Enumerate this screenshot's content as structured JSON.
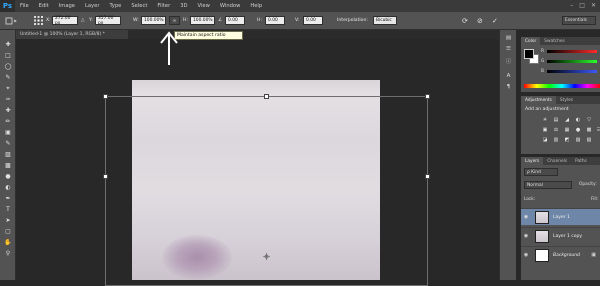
{
  "app": {
    "logo": "Ps"
  },
  "menu": [
    "File",
    "Edit",
    "Image",
    "Layer",
    "Type",
    "Select",
    "Filter",
    "3D",
    "View",
    "Window",
    "Help"
  ],
  "window_controls": [
    "–",
    "□",
    "✕"
  ],
  "options": {
    "x_label": "X:",
    "x_value": "272.00 px",
    "y_label": "Y:",
    "y_value": "357.00 px",
    "w_label": "W:",
    "w_value": "100.00%",
    "link_icon": "∞",
    "h_label": "H:",
    "h_value": "100.00%",
    "angle_value": "0.00",
    "h2_label": "H:",
    "h2_value": "0.00",
    "v_label": "V:",
    "v_value": "0.00",
    "interp_label": "Interpolation:",
    "interp_value": "Bicubic",
    "commit_icons": [
      "⟳",
      "⊘",
      "✓"
    ],
    "workspace": "Essentials"
  },
  "tooltip": "Maintain aspect ratio",
  "document_tab": "Untitled-1 @ 100% (Layer 1, RGB/8) *",
  "color_panel": {
    "tabs": [
      "Color",
      "Swatches"
    ],
    "sliders": [
      {
        "label": "R",
        "color": "#ff2a2a"
      },
      {
        "label": "G",
        "color": "#2aff2a"
      },
      {
        "label": "B",
        "color": "#3a5aff"
      }
    ]
  },
  "adjustments_panel": {
    "tabs": [
      "Adjustments",
      "Styles"
    ],
    "title": "Add an adjustment",
    "rows": [
      [
        "☀",
        "▤",
        "◢",
        "◐",
        "▽"
      ],
      [
        "▣",
        "⚖",
        "▦",
        "●",
        "▩",
        "☷"
      ],
      [
        "◪",
        "▥",
        "◩",
        "▨",
        "▧"
      ]
    ]
  },
  "layers_panel": {
    "tabs": [
      "Layers",
      "Channels",
      "Paths"
    ],
    "filter_label": "ρ Kind",
    "blend_mode": "Normal",
    "opacity_label": "Opacity:",
    "lock_label": "Lock:",
    "fill_label": "Fill:",
    "layers": [
      {
        "name": "Layer 1",
        "visible": "◉",
        "selected": true,
        "thumb": "texture"
      },
      {
        "name": "Layer 1 copy",
        "visible": "◉",
        "selected": false,
        "thumb": "texture"
      },
      {
        "name": "Background",
        "visible": "◉",
        "selected": false,
        "thumb": "white",
        "locked": "🔒"
      }
    ]
  },
  "colors": {
    "accent": "#31a8ff",
    "selected_layer": "#6e86a8",
    "tooltip_bg": "#fffde0"
  }
}
